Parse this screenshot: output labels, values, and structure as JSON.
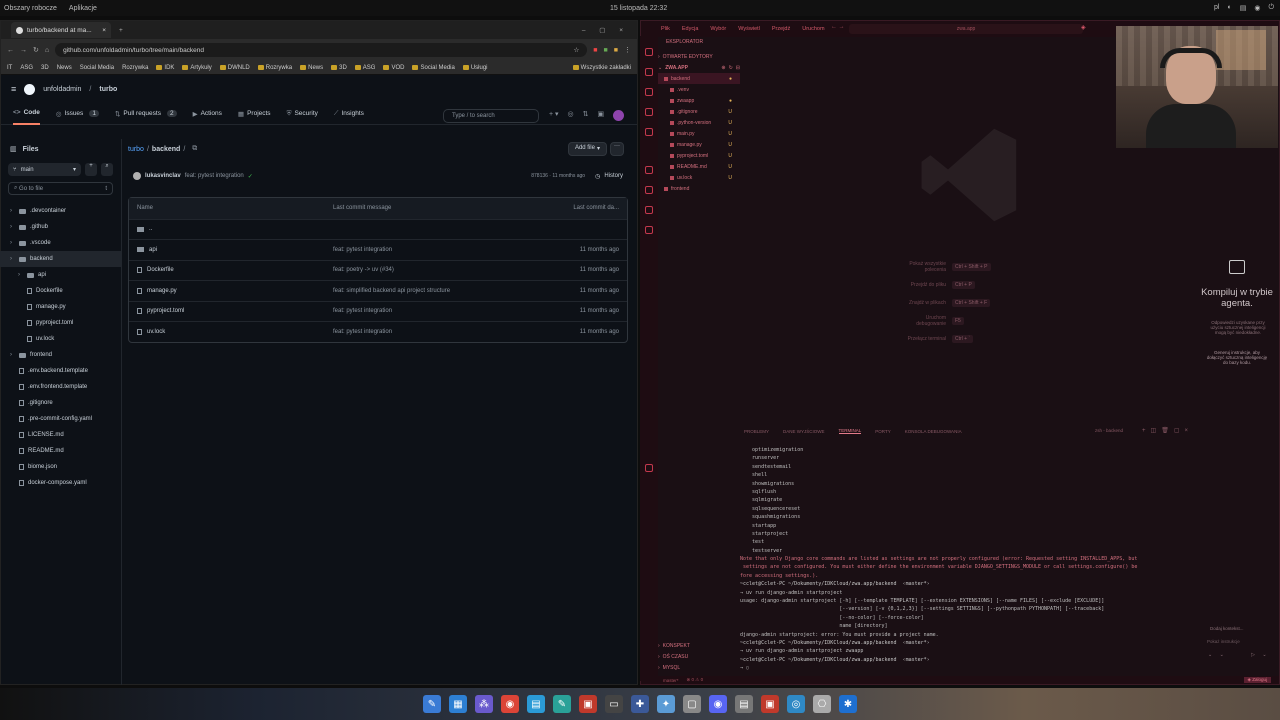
{
  "os_bar": {
    "left_items": [
      "Obszary robocze",
      "Aplikacje"
    ],
    "clock": "15 listopada 22:32",
    "lang": "pl"
  },
  "browser": {
    "tab_title": "turbo/backend at ma...",
    "url": "github.com/unfoldadmin/turbo/tree/main/backend",
    "bookmarks": [
      "IT",
      "ASG",
      "3D",
      "News",
      "Social Media",
      "Rozrywka",
      "IDK",
      "Artykuły",
      "DWNLD",
      "Rozrywka",
      "News",
      "3D",
      "ASG",
      "VOD",
      "Social Media",
      "Usługi"
    ],
    "bookmarks_all": "Wszystkie zakładki"
  },
  "github": {
    "owner": "unfoldadmin",
    "repo": "turbo",
    "search_placeholder": "Type / to search",
    "nav_tabs": [
      {
        "label": "Code",
        "count": ""
      },
      {
        "label": "Issues",
        "count": "1"
      },
      {
        "label": "Pull requests",
        "count": "2"
      },
      {
        "label": "Actions",
        "count": ""
      },
      {
        "label": "Projects",
        "count": ""
      },
      {
        "label": "Security",
        "count": ""
      },
      {
        "label": "Insights",
        "count": ""
      }
    ],
    "files_label": "Files",
    "branch": "main",
    "go_to_file": "Go to file",
    "breadcrumb_repo": "turbo",
    "breadcrumb_dir": "backend",
    "add_file": "Add file",
    "commit_author": "lukasvinclav",
    "commit_message": "feat: pytest integration",
    "commit_hash": "878136 · 11 months ago",
    "history": "History",
    "table_headers": {
      "name": "Name",
      "message": "Last commit message",
      "date": "Last commit da..."
    },
    "parent_dir": "..",
    "rows": [
      {
        "name": "api",
        "message": "feat: pytest integration",
        "date": "11 months ago",
        "type": "folder"
      },
      {
        "name": "Dockerfile",
        "message": "feat: poetry -> uv (#34)",
        "date": "11 months ago",
        "type": "file"
      },
      {
        "name": "manage.py",
        "message": "feat: simplified backend api project structure",
        "date": "11 months ago",
        "type": "file"
      },
      {
        "name": "pyproject.toml",
        "message": "feat: pytest integration",
        "date": "11 months ago",
        "type": "file"
      },
      {
        "name": "uv.lock",
        "message": "feat: pytest integration",
        "date": "11 months ago",
        "type": "file"
      }
    ],
    "tree": [
      {
        "label": ".devcontainer",
        "type": "folder",
        "indent": 0
      },
      {
        "label": ".github",
        "type": "folder",
        "indent": 0
      },
      {
        "label": ".vscode",
        "type": "folder",
        "indent": 0
      },
      {
        "label": "backend",
        "type": "folder",
        "indent": 0,
        "selected": true
      },
      {
        "label": "api",
        "type": "folder",
        "indent": 1
      },
      {
        "label": "Dockerfile",
        "type": "file",
        "indent": 1
      },
      {
        "label": "manage.py",
        "type": "file",
        "indent": 1
      },
      {
        "label": "pyproject.toml",
        "type": "file",
        "indent": 1
      },
      {
        "label": "uv.lock",
        "type": "file",
        "indent": 1
      },
      {
        "label": "frontend",
        "type": "folder",
        "indent": 0
      },
      {
        "label": ".env.backend.template",
        "type": "file",
        "indent": 0
      },
      {
        "label": ".env.frontend.template",
        "type": "file",
        "indent": 0
      },
      {
        "label": ".gitignore",
        "type": "file",
        "indent": 0
      },
      {
        "label": ".pre-commit-config.yaml",
        "type": "file",
        "indent": 0
      },
      {
        "label": "LICENSE.md",
        "type": "file",
        "indent": 0
      },
      {
        "label": "README.md",
        "type": "file",
        "indent": 0
      },
      {
        "label": "biome.json",
        "type": "file",
        "indent": 0
      },
      {
        "label": "docker-compose.yaml",
        "type": "file",
        "indent": 0
      }
    ]
  },
  "vscode": {
    "menu": [
      "Plik",
      "Edycja",
      "Wybór",
      "Wyświetl",
      "Przejdź",
      "Uruchom"
    ],
    "search": "zwa.app",
    "explorer_title": "EKSPLORATOR",
    "open_editors": "OTWARTE EDYTORY",
    "workspace": "ZWA.APP",
    "explorer_items": [
      {
        "label": "backend",
        "status": "●",
        "indent": 1
      },
      {
        "label": ".venv",
        "status": "",
        "indent": 2
      },
      {
        "label": "zwaapp",
        "status": "●",
        "indent": 2
      },
      {
        "label": ".gitignore",
        "status": "U",
        "indent": 2
      },
      {
        "label": ".python-version",
        "status": "U",
        "indent": 2
      },
      {
        "label": "main.py",
        "status": "U",
        "indent": 2
      },
      {
        "label": "manage.py",
        "status": "U",
        "indent": 2
      },
      {
        "label": "pyproject.toml",
        "status": "U",
        "indent": 2
      },
      {
        "label": "README.md",
        "status": "U",
        "indent": 2
      },
      {
        "label": "uv.lock",
        "status": "U",
        "indent": 2
      },
      {
        "label": "frontend",
        "status": "",
        "indent": 1
      }
    ],
    "bottom_sections": [
      "KONSPEKT",
      "OŚ CZASU",
      "MYSQL"
    ],
    "hints": [
      {
        "label": "Pokaż wszystkie polecenia",
        "keys": "Ctrl + Shift + P"
      },
      {
        "label": "Przejdź do pliku",
        "keys": "Ctrl + P"
      },
      {
        "label": "Znajdź w plikach",
        "keys": "Ctrl + Shift + F"
      },
      {
        "label": "Uruchom debugowanie",
        "keys": "F5"
      },
      {
        "label": "Przełącz terminal",
        "keys": "Ctrl + `"
      }
    ],
    "terminal_tabs": [
      "PROBLEMY",
      "DANE WYJŚCIOWE",
      "TERMINAL",
      "PORTY",
      "KONSOLA DEBUGOWANIA"
    ],
    "terminal_shell": "zsh - backend",
    "terminal_lines": [
      {
        "text": "    optimizemigration",
        "kind": "out"
      },
      {
        "text": "    runserver",
        "kind": "out"
      },
      {
        "text": "    sendtestemail",
        "kind": "out"
      },
      {
        "text": "    shell",
        "kind": "out"
      },
      {
        "text": "    showmigrations",
        "kind": "out"
      },
      {
        "text": "    sqlflush",
        "kind": "out"
      },
      {
        "text": "    sqlmigrate",
        "kind": "out"
      },
      {
        "text": "    sqlsequencereset",
        "kind": "out"
      },
      {
        "text": "    squashmigrations",
        "kind": "out"
      },
      {
        "text": "    startapp",
        "kind": "out"
      },
      {
        "text": "    startproject",
        "kind": "out"
      },
      {
        "text": "    test",
        "kind": "out"
      },
      {
        "text": "    testserver",
        "kind": "out"
      },
      {
        "text": "Note that only Django core commands are listed as settings are not properly configured (error: Requested setting INSTALLED_APPS, but",
        "kind": "err"
      },
      {
        "text": " settings are not configured. You must either define the environment variable DJANGO_SETTINGS_MODULE or call settings.configure() be",
        "kind": "err"
      },
      {
        "text": "fore accessing settings.).",
        "kind": "err"
      },
      {
        "text": "~cclet@Cclet-PC ~/Dokumenty/IDKCloud/zwa.app/backend  ‹master*›",
        "kind": "prompt"
      },
      {
        "text": "→ uv run django-admin startproject",
        "kind": "out"
      },
      {
        "text": "usage: django-admin startproject [-h] [--template TEMPLATE] [--extension EXTENSIONS] [--name FILES] [--exclude [EXCLUDE]]",
        "kind": "out"
      },
      {
        "text": "                                 [--version] [-v {0,1,2,3}] [--settings SETTINGS] [--pythonpath PYTHONPATH] [--traceback]",
        "kind": "out"
      },
      {
        "text": "                                 [--no-color] [--force-color]",
        "kind": "out"
      },
      {
        "text": "                                 name [directory]",
        "kind": "out"
      },
      {
        "text": "django-admin startproject: error: You must provide a project name.",
        "kind": "out"
      },
      {
        "text": "~cclet@Cclet-PC ~/Dokumenty/IDKCloud/zwa.app/backend  ‹master*›",
        "kind": "prompt"
      },
      {
        "text": "→ uv run django-admin startproject zwaapp",
        "kind": "out"
      },
      {
        "text": "~cclet@Cclet-PC ~/Dokumenty/IDKCloud/zwa.app/backend  ‹master*›",
        "kind": "prompt"
      },
      {
        "text": "→ ▯",
        "kind": "out"
      }
    ],
    "agent_title": "Kompiluj w trybie agenta.",
    "agent_desc": "Odpowiedzi uzyskane przy użyciu sztucznej inteligencji mogą być niedokładne.",
    "agent_desc2": "Generuj instrukcje, aby dołączyć sztuczną inteligencję do bazy kodu.",
    "agent_input": "Dodaj kontekst...",
    "agent_placeholder": "Pokaż instrukcje",
    "status_left": "master*",
    "colors": {
      "accent": "#e05a6e",
      "bg": "#1a0f14"
    }
  },
  "taskbar": {
    "icons": [
      "files-icon",
      "terminal-icon",
      "apps-icon",
      "chrome-icon",
      "folder-icon",
      "editor-icon",
      "pdf-icon",
      "console-icon",
      "app-icon",
      "kitty-icon",
      "settings-icon",
      "discord-icon",
      "doc-icon",
      "app2-icon",
      "github-icon",
      "vscode-icon",
      "steam-icon"
    ]
  }
}
